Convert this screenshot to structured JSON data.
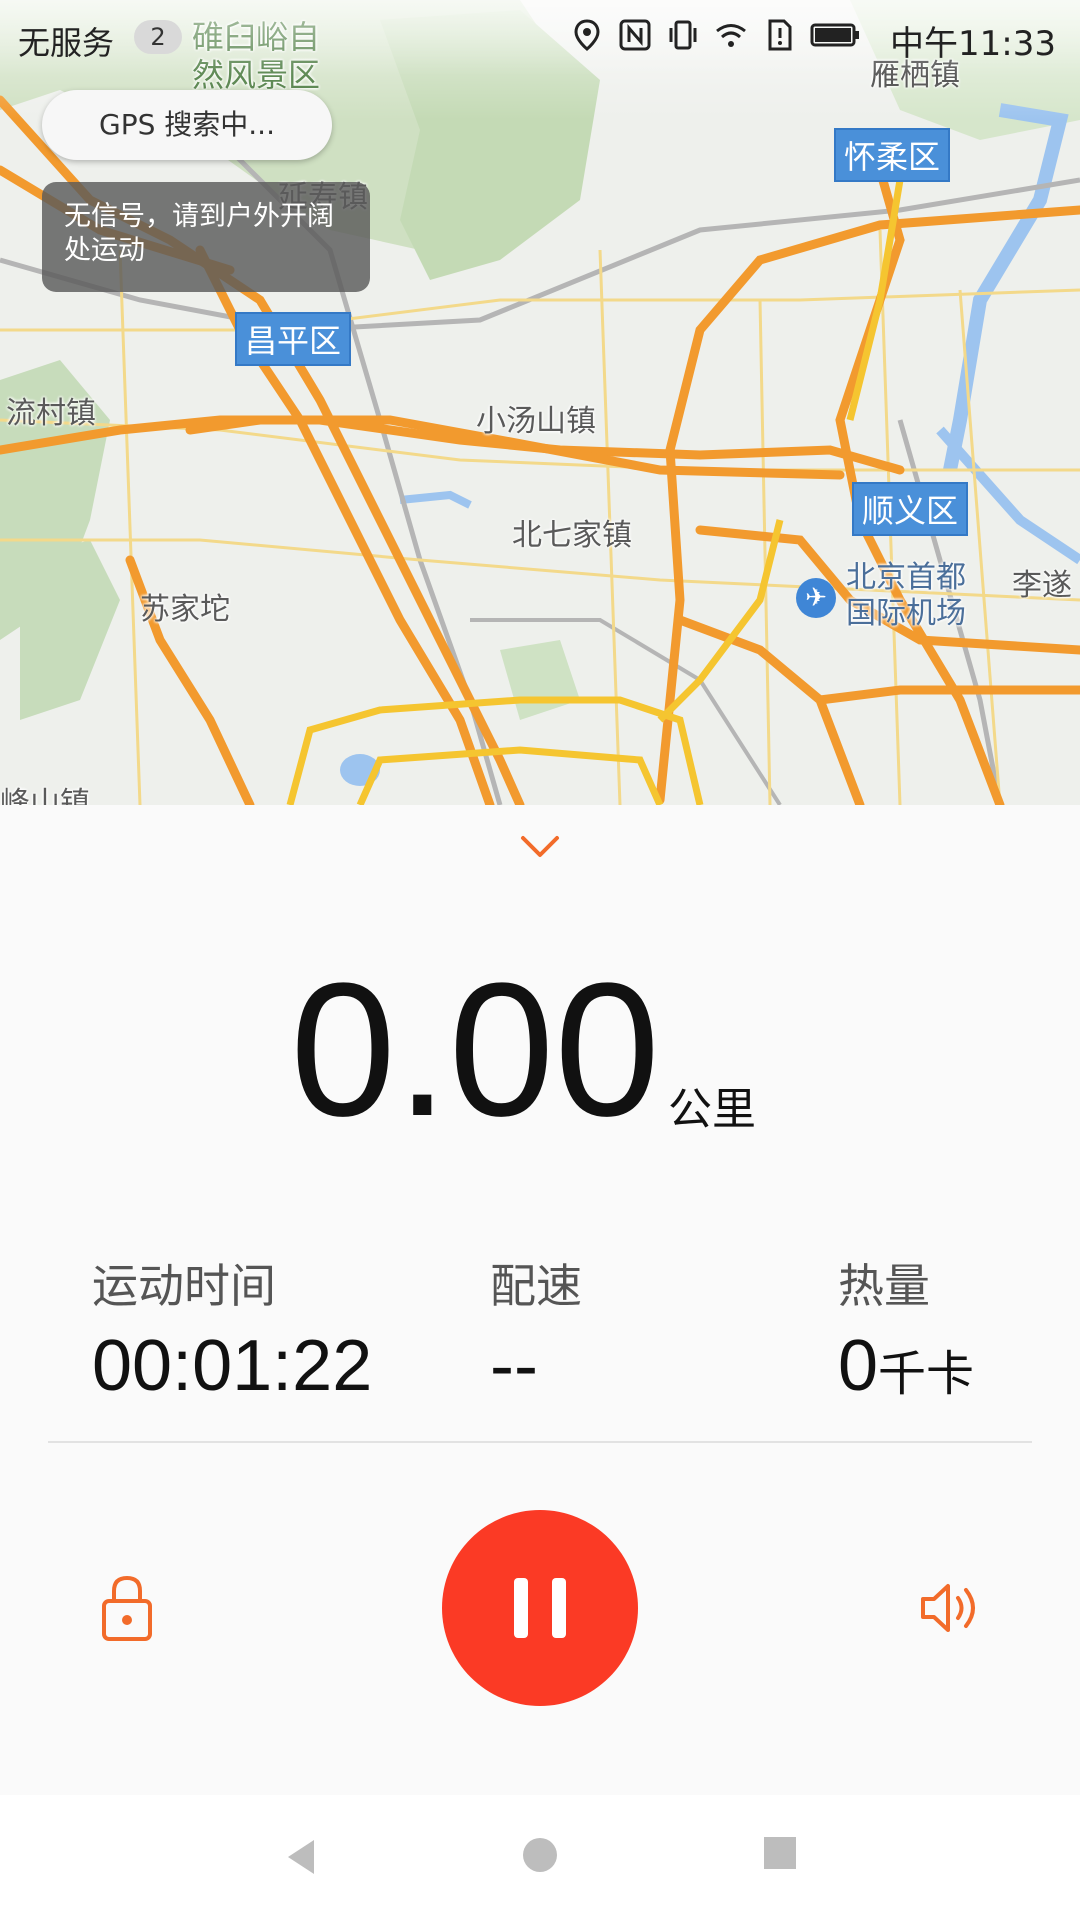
{
  "status_bar": {
    "carrier": "无服务",
    "sim_badge": "2",
    "time": "中午11:33",
    "icons": [
      "location-icon",
      "nfc-icon",
      "vibrate-icon",
      "wifi-icon",
      "sim-alert-icon",
      "battery-icon"
    ]
  },
  "gps": {
    "pill_text": "GPS 搜索中...",
    "toast_text": "无信号，请到户外开阔处运动"
  },
  "map": {
    "labels": {
      "scenic": "碓臼峪自然风景区",
      "yanqi": "雁栖镇",
      "yanshou": "延寿镇",
      "liucun": "流村镇",
      "xiaotangshan": "小汤山镇",
      "beiqijia": "北七家镇",
      "sujiatuo": "苏家坨",
      "airport": "北京首都国际机场",
      "lisui": "李遂",
      "fengshan": "峰山镇"
    },
    "districts": {
      "huairou": "怀柔区",
      "changping": "昌平区",
      "shunyi": "顺义区"
    }
  },
  "workout": {
    "distance": "0.00",
    "distance_unit": "公里",
    "time_label": "运动时间",
    "time_value": "00:01:22",
    "pace_label": "配速",
    "pace_value": "--",
    "calorie_label": "热量",
    "calorie_value": "0",
    "calorie_unit": "千卡"
  },
  "colors": {
    "accent": "#fb3a25",
    "icon_orange": "#f26b2a",
    "road_orange": "#f29a2e",
    "district_blue": "#4a90d9"
  },
  "nav": [
    "back-icon",
    "home-icon",
    "recents-icon"
  ]
}
